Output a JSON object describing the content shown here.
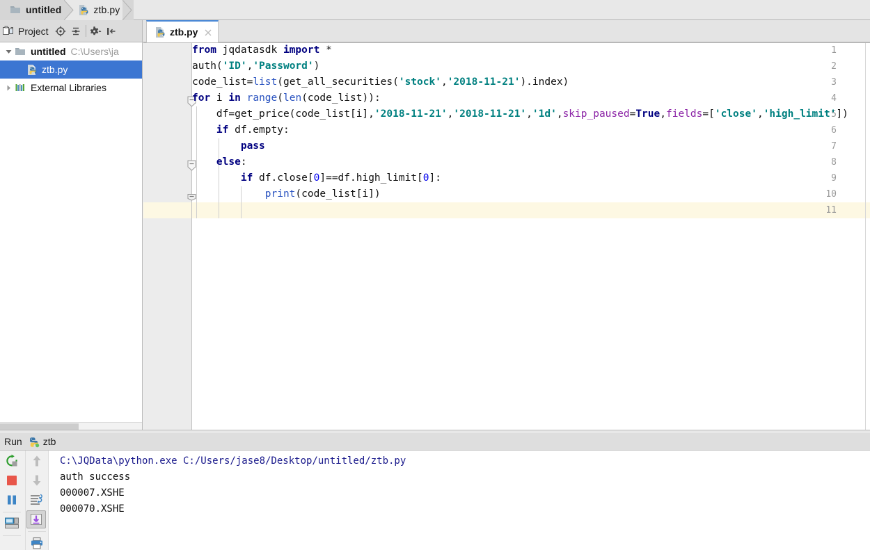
{
  "breadcrumb": {
    "items": [
      {
        "label": "untitled",
        "icon": "folder-icon",
        "bold": true
      },
      {
        "label": "ztb.py",
        "icon": "python-file-icon",
        "bold": false
      }
    ]
  },
  "project_toolbar": {
    "title": "Project",
    "buttons": [
      {
        "name": "locate-icon",
        "tooltip": "Select Opened File"
      },
      {
        "name": "collapse-all-icon",
        "tooltip": "Collapse All"
      },
      {
        "name": "settings-gear-icon",
        "tooltip": "Settings"
      },
      {
        "name": "hide-panel-icon",
        "tooltip": "Hide"
      }
    ]
  },
  "tabs": [
    {
      "label": "ztb.py",
      "icon": "python-file-icon",
      "active": true,
      "close": "×"
    }
  ],
  "project_tree": [
    {
      "label": "untitled",
      "path": "C:\\Users\\ja",
      "icon": "folder-icon",
      "expanded": true,
      "depth": 0,
      "selected": false
    },
    {
      "label": "ztb.py",
      "path": "",
      "icon": "python-file-icon",
      "expanded": null,
      "depth": 1,
      "selected": true
    },
    {
      "label": "External Libraries",
      "path": "",
      "icon": "libraries-icon",
      "expanded": false,
      "depth": 0,
      "selected": false
    }
  ],
  "editor": {
    "file": "ztb.py",
    "current_line": 11,
    "total_lines": 11,
    "line_numbers": [
      "1",
      "2",
      "3",
      "4",
      "5",
      "6",
      "7",
      "8",
      "9",
      "10",
      "11"
    ],
    "lines": [
      {
        "n": 1,
        "tokens": [
          {
            "t": "from",
            "c": "kw"
          },
          {
            "t": " jqdatasdk ",
            "c": "plain"
          },
          {
            "t": "import",
            "c": "kw"
          },
          {
            "t": " *",
            "c": "plain"
          }
        ]
      },
      {
        "n": 2,
        "tokens": [
          {
            "t": "auth(",
            "c": "plain"
          },
          {
            "t": "'ID'",
            "c": "str"
          },
          {
            "t": ",",
            "c": "plain"
          },
          {
            "t": "'Password'",
            "c": "str"
          },
          {
            "t": ")",
            "c": "plain"
          }
        ]
      },
      {
        "n": 3,
        "tokens": [
          {
            "t": "code_list=",
            "c": "plain"
          },
          {
            "t": "list",
            "c": "bif"
          },
          {
            "t": "(get_all_securities(",
            "c": "plain"
          },
          {
            "t": "'stock'",
            "c": "str"
          },
          {
            "t": ",",
            "c": "plain"
          },
          {
            "t": "'2018-11-21'",
            "c": "str"
          },
          {
            "t": ").index)",
            "c": "plain"
          }
        ]
      },
      {
        "n": 4,
        "tokens": [
          {
            "t": "for",
            "c": "kw"
          },
          {
            "t": " i ",
            "c": "plain"
          },
          {
            "t": "in",
            "c": "kw"
          },
          {
            "t": " ",
            "c": "plain"
          },
          {
            "t": "range",
            "c": "bif"
          },
          {
            "t": "(",
            "c": "plain"
          },
          {
            "t": "len",
            "c": "bif"
          },
          {
            "t": "(code_list)):",
            "c": "plain"
          }
        ]
      },
      {
        "n": 5,
        "tokens": [
          {
            "t": "    df=get_price(code_list[i],",
            "c": "plain"
          },
          {
            "t": "'2018-11-21'",
            "c": "str"
          },
          {
            "t": ",",
            "c": "plain"
          },
          {
            "t": "'2018-11-21'",
            "c": "str"
          },
          {
            "t": ",",
            "c": "plain"
          },
          {
            "t": "'1d'",
            "c": "str"
          },
          {
            "t": ",",
            "c": "plain"
          },
          {
            "t": "skip_paused",
            "c": "kwarg"
          },
          {
            "t": "=",
            "c": "plain"
          },
          {
            "t": "True",
            "c": "kw"
          },
          {
            "t": ",",
            "c": "plain"
          },
          {
            "t": "fields",
            "c": "kwarg"
          },
          {
            "t": "=[",
            "c": "plain"
          },
          {
            "t": "'close'",
            "c": "str"
          },
          {
            "t": ",",
            "c": "plain"
          },
          {
            "t": "'high_limit'",
            "c": "str"
          },
          {
            "t": "])",
            "c": "plain"
          }
        ]
      },
      {
        "n": 6,
        "tokens": [
          {
            "t": "    ",
            "c": "plain"
          },
          {
            "t": "if",
            "c": "kw"
          },
          {
            "t": " df.empty:",
            "c": "plain"
          }
        ]
      },
      {
        "n": 7,
        "tokens": [
          {
            "t": "        ",
            "c": "plain"
          },
          {
            "t": "pass",
            "c": "kw"
          }
        ]
      },
      {
        "n": 8,
        "tokens": [
          {
            "t": "    ",
            "c": "plain"
          },
          {
            "t": "else",
            "c": "kw"
          },
          {
            "t": ":",
            "c": "plain"
          }
        ]
      },
      {
        "n": 9,
        "tokens": [
          {
            "t": "        ",
            "c": "plain"
          },
          {
            "t": "if",
            "c": "kw"
          },
          {
            "t": " df.close[",
            "c": "plain"
          },
          {
            "t": "0",
            "c": "num"
          },
          {
            "t": "]==df.high_limit[",
            "c": "plain"
          },
          {
            "t": "0",
            "c": "num"
          },
          {
            "t": "]:",
            "c": "plain"
          }
        ]
      },
      {
        "n": 10,
        "tokens": [
          {
            "t": "            ",
            "c": "plain"
          },
          {
            "t": "print",
            "c": "bif"
          },
          {
            "t": "(code_list[i])",
            "c": "plain"
          }
        ]
      },
      {
        "n": 11,
        "tokens": []
      }
    ],
    "fold_markers": [
      4,
      8,
      10
    ]
  },
  "run_panel": {
    "title": "Run",
    "config_name": "ztb",
    "config_icon": "python-run-icon",
    "left_buttons": [
      {
        "name": "rerun-icon",
        "tooltip": "Rerun",
        "color": "#3c9a3c"
      },
      {
        "name": "stop-icon",
        "tooltip": "Stop",
        "color": "#e8564a"
      },
      {
        "name": "pause-icon",
        "tooltip": "Pause Output",
        "color": "#3d85c6"
      },
      {
        "name": "layout-icon",
        "tooltip": "Toggle Layout",
        "color": "#3d85c6"
      }
    ],
    "right_buttons": [
      {
        "name": "arrow-up-icon",
        "tooltip": "Up the Stack Trace",
        "pressed": false
      },
      {
        "name": "arrow-down-icon",
        "tooltip": "Down the Stack Trace",
        "pressed": false
      },
      {
        "name": "soft-wrap-icon",
        "tooltip": "Use Soft Wraps",
        "pressed": false
      },
      {
        "name": "scroll-to-end-icon",
        "tooltip": "Scroll to End",
        "pressed": true
      },
      {
        "name": "print-icon",
        "tooltip": "Print",
        "pressed": false
      }
    ],
    "console_lines": [
      {
        "text": "C:\\JQData\\python.exe C:/Users/jase8/Desktop/untitled/ztb.py",
        "kind": "command"
      },
      {
        "text": "auth success",
        "kind": "output"
      },
      {
        "text": "000007.XSHE",
        "kind": "output"
      },
      {
        "text": "000070.XSHE",
        "kind": "output"
      }
    ]
  },
  "colors": {
    "selection_blue": "#3c76d2",
    "tab_accent": "#4a88d6",
    "keyword": "#000080",
    "string": "#008080",
    "builtin": "#2a53c0",
    "number": "#0000ee",
    "kwarg": "#8b23a6",
    "current_line": "#fdf8e3"
  }
}
